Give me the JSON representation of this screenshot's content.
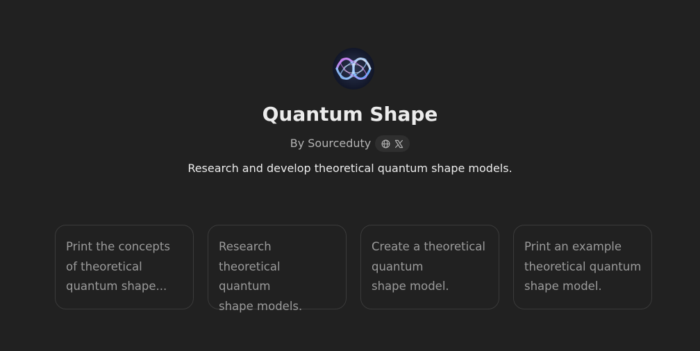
{
  "gpt": {
    "avatar_icon": "quantum-knot-icon",
    "name": "Quantum Shape",
    "author": "By Sourceduty",
    "description": "Research and develop theoretical quantum shape models."
  },
  "social_links": [
    {
      "icon": "globe-icon"
    },
    {
      "icon": "x-logo-icon"
    }
  ],
  "conversation_starters": [
    {
      "text": "Print the concepts\nof theoretical\nquantum shape..."
    },
    {
      "text": "Research theoretical\nquantum\nshape models."
    },
    {
      "text": "Create a theoretical\nquantum\nshape model."
    },
    {
      "text": "Print an example\ntheoretical quantum\nshape model."
    }
  ],
  "colors": {
    "background": "#212121",
    "card_border": "#3b3b3b",
    "muted_text": "#9b9b9b",
    "primary_text": "#ececec"
  }
}
